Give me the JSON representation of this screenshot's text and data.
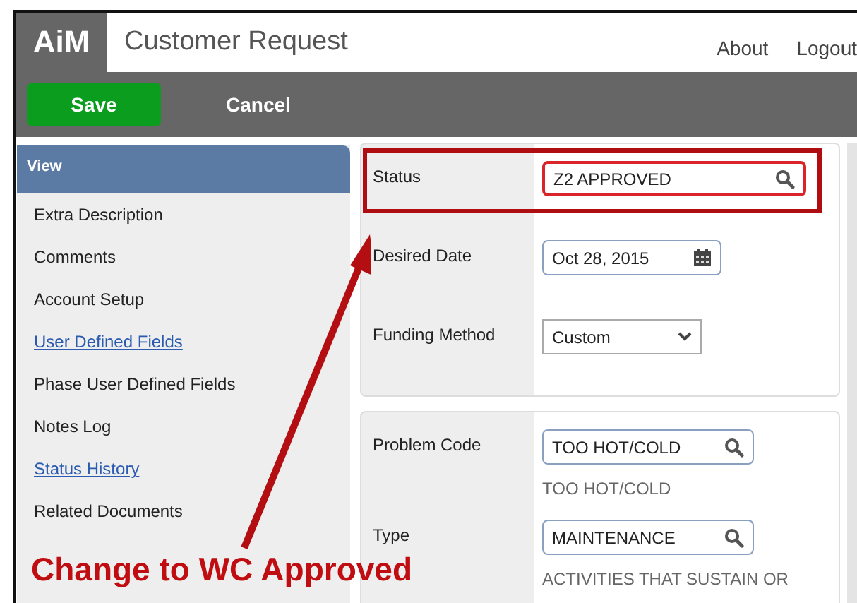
{
  "app": {
    "logo": "AiM",
    "title": "Customer Request",
    "links": [
      "About",
      "Logout"
    ]
  },
  "toolbar": {
    "buttons": [
      {
        "label": "Save",
        "kind": "primary"
      },
      {
        "label": "Cancel",
        "kind": "plain"
      }
    ]
  },
  "sidebar": {
    "header": "View",
    "items": [
      {
        "label": "Extra Description",
        "link": false
      },
      {
        "label": "Comments",
        "link": false
      },
      {
        "label": "Account Setup",
        "link": false
      },
      {
        "label": "User Defined Fields",
        "link": true
      },
      {
        "label": "Phase User Defined Fields",
        "link": false
      },
      {
        "label": "Notes Log",
        "link": false
      },
      {
        "label": "Status History",
        "link": true
      },
      {
        "label": "Related Documents",
        "link": false
      }
    ]
  },
  "sections": [
    {
      "rows": [
        {
          "label": "Status",
          "kind": "lookup",
          "value": "Z2 APPROVED",
          "highlighted": true
        },
        {
          "label": "Desired Date",
          "kind": "date",
          "value": "Oct 28, 2015",
          "highlighted": false
        },
        {
          "label": "Funding Method",
          "kind": "select",
          "value": "Custom",
          "highlighted": false
        }
      ]
    },
    {
      "rows": [
        {
          "label": "Problem Code",
          "kind": "lookup",
          "value": "TOO HOT/COLD",
          "description": "TOO HOT/COLD",
          "highlighted": false
        },
        {
          "label": "Type",
          "kind": "lookup",
          "value": "MAINTENANCE",
          "description": "ACTIVITIES THAT SUSTAIN OR",
          "highlighted": false
        }
      ]
    }
  ],
  "annotation": {
    "text": "Change to WC Approved"
  }
}
